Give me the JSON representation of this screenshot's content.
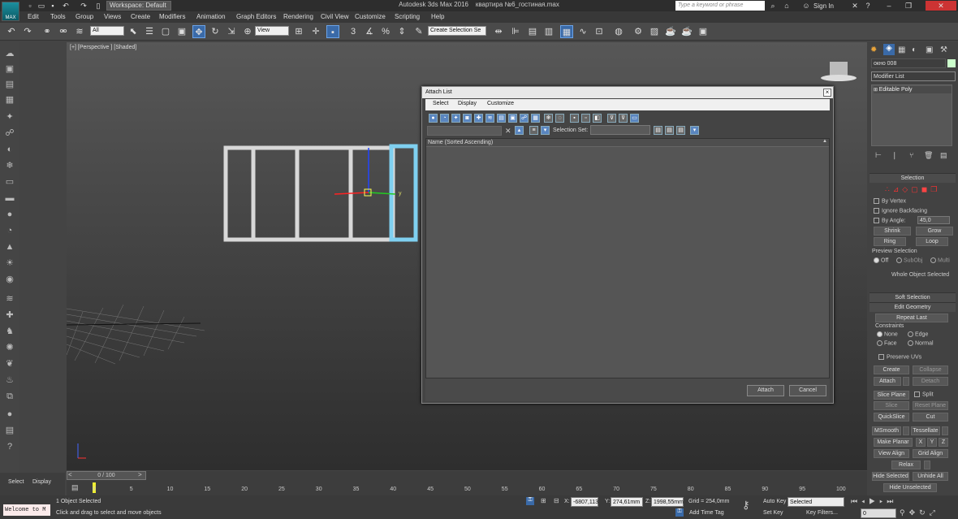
{
  "title_bar": {
    "app": "Autodesk 3ds Max 2016",
    "file": "квартира №6_гостиная.max",
    "workspace": "Workspace: Default",
    "search_placeholder": "Type a keyword or phrase",
    "sign_in": "Sign In",
    "logo": "MAX"
  },
  "menu": [
    "Edit",
    "Tools",
    "Group",
    "Views",
    "Create",
    "Modifiers",
    "Animation",
    "Graph Editors",
    "Rendering",
    "Civil View",
    "Customize",
    "Scripting",
    "Help"
  ],
  "toolbar": {
    "filter_value": "All",
    "view_value": "View",
    "selection_set_value": "Create Selection Se"
  },
  "viewport": {
    "label": "[+] [Perspective ] [Shaded]",
    "axis_y": "y"
  },
  "dialog": {
    "title": "Attach List",
    "close": "×",
    "menu": [
      "Select",
      "Display",
      "Customize"
    ],
    "selection_set_label": "Selection Set:",
    "column_header": "Name (Sorted Ascending)",
    "attach_label": "Attach",
    "cancel_label": "Cancel"
  },
  "command_panel": {
    "object_name": "окно 008",
    "modifier_list": "Modifier List",
    "stack_item": "Editable Poly",
    "selection": {
      "title": "Selection",
      "by_vertex": "By Vertex",
      "ignore_backfacing": "Ignore Backfacing",
      "by_angle": "By Angle:",
      "angle_value": "45,0",
      "shrink": "Shrink",
      "grow": "Grow",
      "ring": "Ring",
      "loop": "Loop",
      "preview_title": "Preview Selection",
      "preview_opts": [
        "Off",
        "SubObj",
        "Multi"
      ],
      "whole_object": "Whole Object Selected"
    },
    "soft_selection": "Soft Selection",
    "edit_geometry": {
      "title": "Edit Geometry",
      "repeat_last": "Repeat Last",
      "constraints": "Constraints",
      "c_opts": [
        "None",
        "Edge",
        "Face",
        "Normal"
      ],
      "preserve_uvs": "Preserve UVs",
      "create": "Create",
      "collapse": "Collapse",
      "attach": "Attach",
      "detach": "Detach",
      "slice_plane": "Slice Plane",
      "split": "Split",
      "slice": "Slice",
      "reset_plane": "Reset Plane",
      "quickslice": "QuickSlice",
      "cut": "Cut",
      "msmooth": "MSmooth",
      "tessellate": "Tessellate",
      "make_planar": "Make Planar",
      "x": "X",
      "y": "Y",
      "z": "Z",
      "view_align": "View Align",
      "grid_align": "Grid Align",
      "relax": "Relax",
      "hide_selected": "Hide Selected",
      "unhide_all": "Unhide All",
      "hide_unselected": "Hide Unselected"
    }
  },
  "left_tabs": [
    "Select",
    "Display"
  ],
  "timeline": {
    "slider": "0 / 100",
    "ticks": [
      "0",
      "5",
      "10",
      "15",
      "20",
      "25",
      "30",
      "35",
      "40",
      "45",
      "50",
      "55",
      "60",
      "65",
      "70",
      "75",
      "80",
      "85",
      "90",
      "95",
      "100"
    ]
  },
  "status": {
    "welcome": "Welcome to M",
    "objects_selected": "1 Object Selected",
    "prompt": "Click and drag to select and move objects",
    "x_label": "X:",
    "x_value": "-6807,113",
    "y_label": "Y:",
    "y_value": "274,61mm",
    "z_label": "Z:",
    "z_value": "1998,55mm",
    "grid": "Grid = 254,0mm",
    "add_time_tag": "Add Time Tag",
    "auto_key": "Auto Key",
    "set_key": "Set Key",
    "selected_value": "Selected",
    "key_filters": "Key Filters...",
    "frame_value": "0"
  }
}
